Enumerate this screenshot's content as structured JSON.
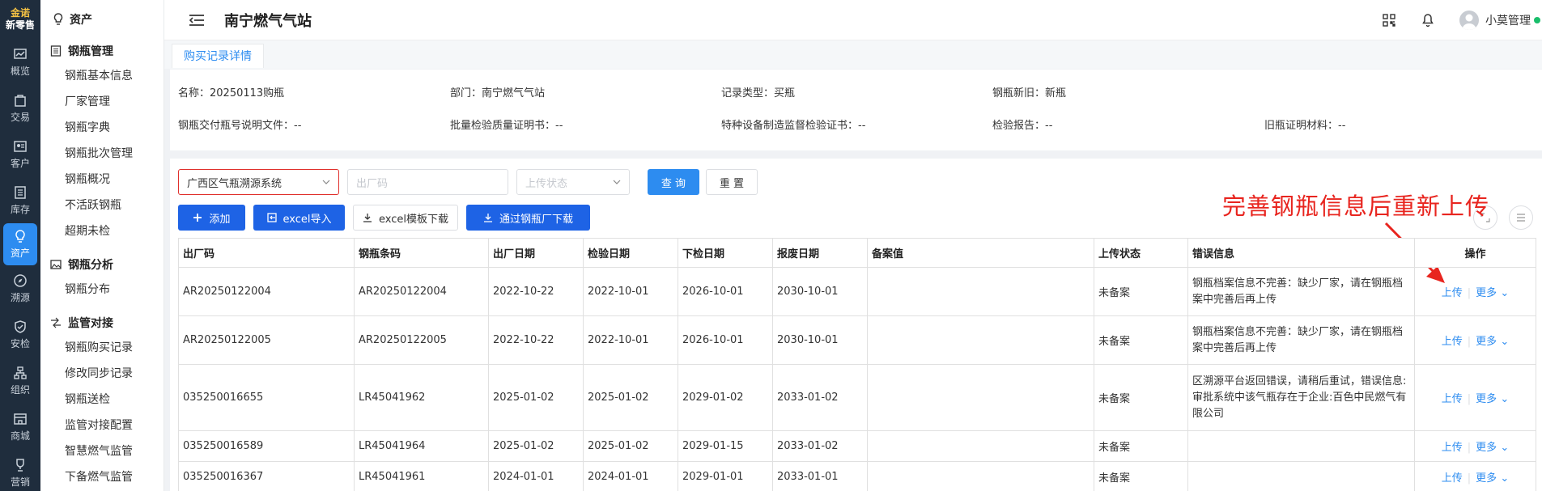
{
  "logo": {
    "line1": "金诺",
    "line2": "新零售"
  },
  "rail": [
    {
      "label": "概览",
      "icon": "chart-icon"
    },
    {
      "label": "交易",
      "icon": "bag-icon"
    },
    {
      "label": "客户",
      "icon": "id-card-icon"
    },
    {
      "label": "库存",
      "icon": "list-icon"
    },
    {
      "label": "资产",
      "icon": "bulb-icon",
      "active": true
    },
    {
      "label": "溯源",
      "icon": "compass-icon"
    },
    {
      "label": "安检",
      "icon": "shield-icon"
    },
    {
      "label": "组织",
      "icon": "org-icon"
    },
    {
      "label": "商城",
      "icon": "store-icon"
    },
    {
      "label": "营销",
      "icon": "trophy-icon"
    }
  ],
  "sidebar": {
    "title": "资产",
    "groups": [
      {
        "title": "钢瓶管理",
        "items": [
          "钢瓶基本信息",
          "厂家管理",
          "钢瓶字典",
          "钢瓶批次管理",
          "钢瓶概况",
          "不活跃钢瓶",
          "超期未检"
        ]
      },
      {
        "title": "钢瓶分析",
        "items": [
          "钢瓶分布"
        ]
      },
      {
        "title": "监管对接",
        "items": [
          "钢瓶购买记录",
          "修改同步记录",
          "钢瓶送检",
          "监管对接配置",
          "智慧燃气监管",
          "下备燃气监管"
        ]
      }
    ]
  },
  "header": {
    "title": "南宁燃气气站",
    "user": "小莫管理"
  },
  "tab": "购买记录详情",
  "info": {
    "row1": [
      "名称：20250113购瓶",
      "部门：南宁燃气气站",
      "记录类型：买瓶",
      "钢瓶新旧：新瓶"
    ],
    "row2": [
      "钢瓶交付瓶号说明文件：--",
      "批量检验质量证明书：--",
      "特种设备制造监督检验证书：--",
      "检验报告：--",
      "旧瓶证明材料：--"
    ]
  },
  "filters": {
    "system": "广西区气瓶溯源系统",
    "factory_code_placeholder": "出厂码",
    "upload_status_placeholder": "上传状态",
    "query": "查 询",
    "reset": "重 置"
  },
  "actions": {
    "add": "添加",
    "excel_import": "excel导入",
    "excel_template": "excel模板下载",
    "download_from_factory": "通过钢瓶厂下载"
  },
  "annotation": "完善钢瓶信息后重新上传",
  "table": {
    "headers": [
      "出厂码",
      "钢瓶条码",
      "出厂日期",
      "检验日期",
      "下检日期",
      "报废日期",
      "备案值",
      "上传状态",
      "错误信息",
      "操作"
    ],
    "rows": [
      [
        "AR20250122004",
        "AR20250122004",
        "2022-10-22",
        "2022-10-01",
        "2026-10-01",
        "2030-10-01",
        "",
        "未备案",
        "钢瓶档案信息不完善：缺少厂家，请在钢瓶档案中完善后再上传"
      ],
      [
        "AR20250122005",
        "AR20250122005",
        "2022-10-22",
        "2022-10-01",
        "2026-10-01",
        "2030-10-01",
        "",
        "未备案",
        "钢瓶档案信息不完善：缺少厂家，请在钢瓶档案中完善后再上传"
      ],
      [
        "035250016655",
        "LR45041962",
        "2025-01-02",
        "2025-01-02",
        "2029-01-02",
        "2033-01-02",
        "",
        "未备案",
        "区溯源平台返回错误，请稍后重试，错误信息:审批系统中该气瓶存在于企业:百色中民燃气有限公司"
      ],
      [
        "035250016589",
        "LR45041964",
        "2025-01-02",
        "2025-01-02",
        "2029-01-15",
        "2033-01-02",
        "",
        "未备案",
        ""
      ],
      [
        "035250016367",
        "LR45041961",
        "2024-01-01",
        "2024-01-01",
        "2029-01-01",
        "2033-01-01",
        "",
        "未备案",
        ""
      ]
    ],
    "op_upload": "上传",
    "op_more": "更多"
  },
  "colors": {
    "primary": "#2d8cf0",
    "dark_button": "#1e63e5",
    "annotation": "#e8251f",
    "rail": "#1f2d3d"
  }
}
